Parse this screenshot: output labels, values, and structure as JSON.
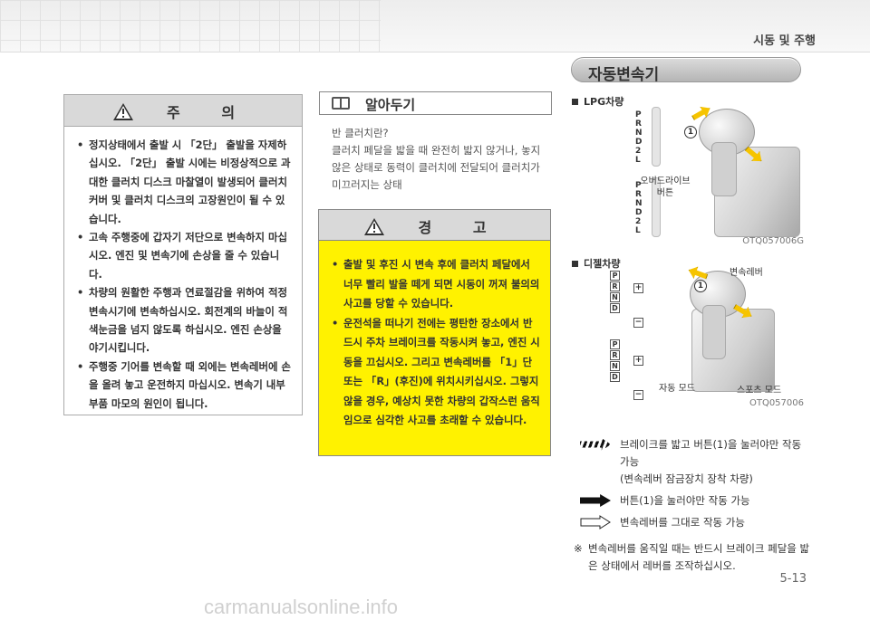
{
  "header": {
    "chapter": "시동 및 주행"
  },
  "section": {
    "title": "자동변속기"
  },
  "caution": {
    "title": "주 의",
    "items": [
      "정지상태에서 출발 시 「2단」 출발을 자제하십시오. 「2단」 출발 시에는 비정상적으로 과대한 클러치 디스크 마찰열이 발생되어 클러치 커버 및 클러치 디스크의 고장원인이 될 수 있습니다.",
      "고속 주행중에 갑자기 저단으로 변속하지 마십시오. 엔진 및 변속기에 손상을 줄 수 있습니다.",
      "차량의 원활한 주행과 연료절감을 위하여 적정 변속시기에 변속하십시오. 회전계의 바늘이 적색눈금을 넘지 않도록 하십시오. 엔진 손상을 야기시킵니다.",
      "주행중 기어를 변속할 때 외에는 변속레버에 손을 올려 놓고 운전하지 마십시오. 변속기 내부 부품 마모의 원인이 됩니다."
    ]
  },
  "info": {
    "title": "알아두기",
    "question": "반 클러치란?",
    "body": "클러치 페달을 밟을 때 완전히 밟지 않거나, 놓지 않은 상태로 동력이 클러치에 전달되어 클러치가 미끄러지는 상태"
  },
  "warning": {
    "title": "경 고",
    "items": [
      "출발 및 후진 시 변속 후에 클러치 페달에서 너무 빨리 발을 떼게 되면 시동이 꺼져 불의의 사고를 당할 수 있습니다.",
      "운전석을 떠나기 전에는 평탄한 장소에서 반드시 주차 브레이크를 작동시켜 놓고, 엔진 시동을 끄십시오. 그리고 변속레버를 「1」단 또는 「R」(후진)에 위치시키십시오. 그렇지 않을 경우, 예상치 못한 차량의 갑작스런 움직임으로 심각한 사고를 초래할 수 있습니다."
    ]
  },
  "figure_lpg": {
    "label": "LPG차량",
    "callout_number": "1",
    "callout_text": "오버드라이브\n버튼",
    "code": "OTQ057006G",
    "gate_letters": [
      "P",
      "R",
      "N",
      "D",
      "2",
      "L"
    ]
  },
  "figure_diesel": {
    "label": "디젤차량",
    "callout_number": "1",
    "callout_lever": "변속레버",
    "callout_auto": "자동 모드",
    "callout_sport": "스포츠 모드",
    "code": "OTQ057006",
    "gate_letters": [
      "P",
      "R",
      "N",
      "D"
    ],
    "plus": "+",
    "minus": "−"
  },
  "legend": {
    "row1": "브레이크를 밟고 버튼(1)을 눌러야만 작동 가능",
    "row1b": "(변속레버 잠금장치 장착 차량)",
    "row2": "버튼(1)을 눌러야만 작동 가능",
    "row3": "변속레버를 그대로 작동 가능",
    "note_mark": "※",
    "note": "변속레버를 움직일 때는 반드시 브레이크 페달을 밟은 상태에서 레버를 조작하십시오."
  },
  "page": {
    "number": "5-13",
    "watermark": "carmanualsonline.info"
  },
  "colors": {
    "warning_bg": "#fff200",
    "box_header": "#d9d9d9",
    "arrow_yellow": "#f6c400"
  }
}
